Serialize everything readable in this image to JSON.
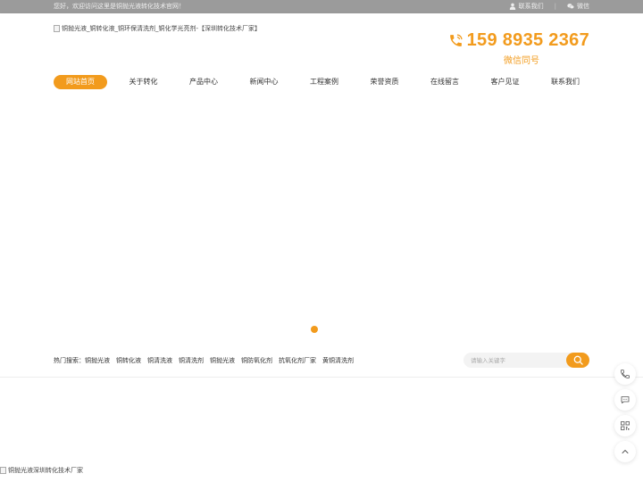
{
  "topbar": {
    "welcome": "您好，欢迎访问这里是铜抛光液转化技术官网！",
    "contact_label": "联系我们",
    "wechat_label": "微信"
  },
  "header": {
    "logo_alt": "铜抛光液_铜转化液_铜环保清洗剂_铜化学光亮剂-【深圳转化技术厂家】",
    "phone": "159 8935 2367",
    "wechat_ask": "微信同号"
  },
  "nav": {
    "items": [
      "网站首页",
      "关于转化",
      "产品中心",
      "新闻中心",
      "工程案例",
      "荣誉资质",
      "在线留言",
      "客户见证",
      "联系我们"
    ]
  },
  "hot_search": {
    "label": "热门搜索：",
    "keywords": [
      "铜抛光液",
      "铜转化液",
      "铜清洗液",
      "铜清洗剂",
      "铜抛光液",
      "铜防氧化剂",
      "抗氧化剂厂家",
      "黄铜清洗剂"
    ]
  },
  "search": {
    "placeholder": "请输入关键字"
  },
  "footer_image": {
    "alt": "铜抛光液深圳转化技术厂家"
  },
  "colors": {
    "accent": "#f29b1d",
    "topbar_bg": "#9b9b9b"
  },
  "icons": {
    "contact": "user-icon",
    "wechat": "wechat-icon",
    "phone": "phone-icon",
    "search": "search-icon",
    "side_phone": "phone-icon",
    "side_chat": "chat-icon",
    "side_qr": "qr-code-icon",
    "side_top": "chevron-up-icon"
  }
}
